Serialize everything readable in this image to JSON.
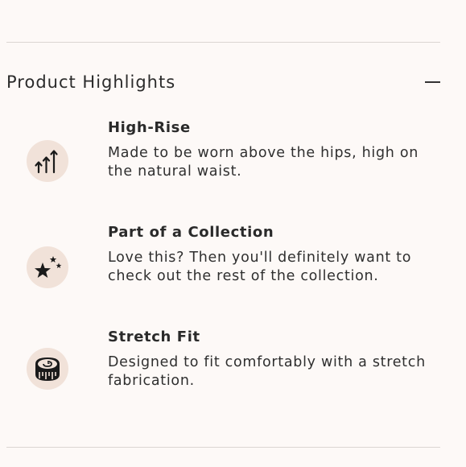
{
  "section": {
    "title": "Product Highlights",
    "toggle_icon": "minus-icon"
  },
  "highlights": [
    {
      "title": "High-Rise",
      "description": "Made to be worn above the hips, high on the natural waist.",
      "icon": "rising-arrows-icon"
    },
    {
      "title": "Part of a Collection",
      "description": "Love this? Then you'll definitely want to check out the rest of the collection.",
      "icon": "stars-icon"
    },
    {
      "title": "Stretch Fit",
      "description": "Designed to fit comfortably with a stretch fabrication.",
      "icon": "measuring-tape-icon"
    }
  ],
  "colors": {
    "background": "#fdf9f7",
    "icon_circle": "#f1e2d9",
    "text": "#2a2a2a",
    "divider": "#dcd6d3"
  }
}
